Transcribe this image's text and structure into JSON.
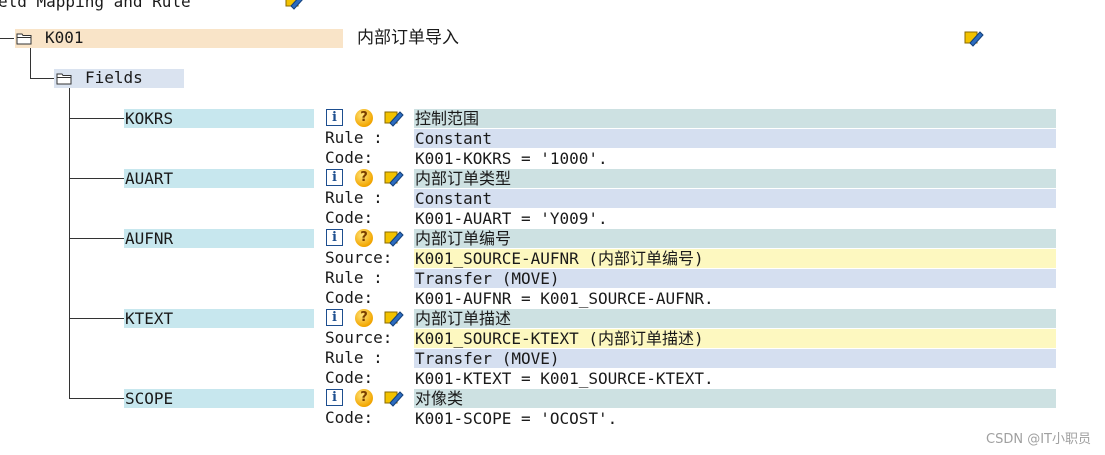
{
  "header": {
    "title": "eld Mapping and Rule"
  },
  "root": {
    "code": "K001",
    "description": "内部订单导入"
  },
  "fields_node": {
    "label": "Fields"
  },
  "labels": {
    "source": "Source:",
    "rule": "Rule :",
    "code": "Code:"
  },
  "fields": [
    {
      "name": "KOKRS",
      "title": "控制范围",
      "rule": "Constant",
      "code": "K001-KOKRS = '1000'."
    },
    {
      "name": "AUART",
      "title": "内部订单类型",
      "rule": "Constant",
      "code": "K001-AUART = 'Y009'."
    },
    {
      "name": "AUFNR",
      "title": "内部订单编号",
      "source": "K001_SOURCE-AUFNR (内部订单编号)",
      "rule": "Transfer (MOVE)",
      "code": "K001-AUFNR = K001_SOURCE-AUFNR."
    },
    {
      "name": "KTEXT",
      "title": "内部订单描述",
      "source": "K001_SOURCE-KTEXT (内部订单描述)",
      "rule": "Transfer (MOVE)",
      "code": "K001-KTEXT = K001_SOURCE-KTEXT."
    },
    {
      "name": "SCOPE",
      "title": "对像类",
      "code": "K001-SCOPE = 'OCOST'."
    }
  ],
  "watermark": "CSDN @IT小职员",
  "icons": {
    "folder": "folder-icon",
    "info": "info-icon",
    "help": "help-icon",
    "edit": "edit-pencil-icon"
  },
  "colors": {
    "root_bg": "#f9e4c8",
    "fields_bg": "#dae3f0",
    "field_name_bg": "#c7e7ee",
    "title_bg": "#cde1e2",
    "source_bg": "#fdf8c0",
    "rule_bg": "#d5dff0"
  }
}
